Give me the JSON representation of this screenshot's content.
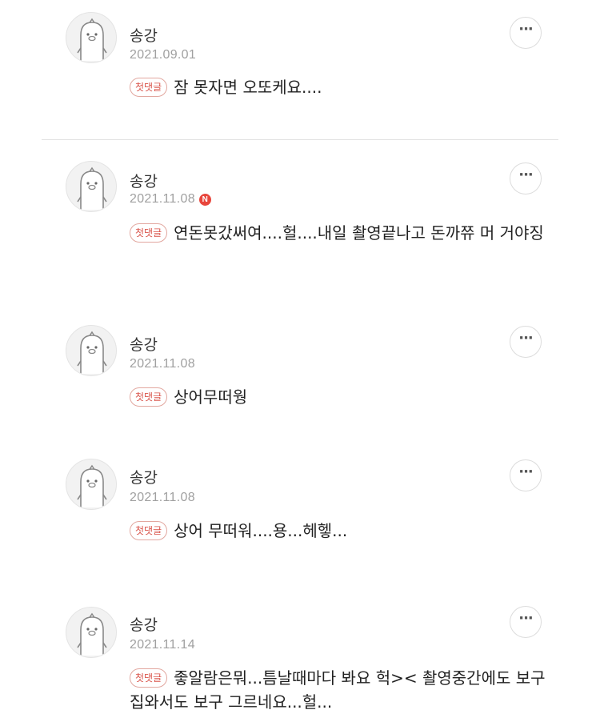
{
  "comments": [
    {
      "author": "송강",
      "date": "2021.09.01",
      "badge": "첫댓글",
      "text": "잠 못자면 오또케요....",
      "is_new": false
    },
    {
      "author": "송강",
      "date": "2021.11.08",
      "badge": "첫댓글",
      "text": "연돈못갔써여....헐....내일 촬영끝나고 돈까쮸 머 거야징",
      "is_new": true,
      "new_label": "N"
    },
    {
      "author": "송강",
      "date": "2021.11.08",
      "badge": "첫댓글",
      "text": "상어무떠웡",
      "is_new": false
    },
    {
      "author": "송강",
      "date": "2021.11.08",
      "badge": "첫댓글",
      "text": "상어 무떠워....용...헤헿...",
      "is_new": false
    },
    {
      "author": "송강",
      "date": "2021.11.14",
      "badge": "첫댓글",
      "text": "좋알람은뭐...틈날때마다 봐요 헉>< 촬영중간에도 보구 집와서도 보구 그르네요...헐...",
      "is_new": false
    }
  ],
  "more_label": "···",
  "colors": {
    "badge_text": "#d9534a",
    "badge_border": "#e2a79f",
    "new_badge": "#e8463c",
    "date": "#a0a0a0"
  }
}
